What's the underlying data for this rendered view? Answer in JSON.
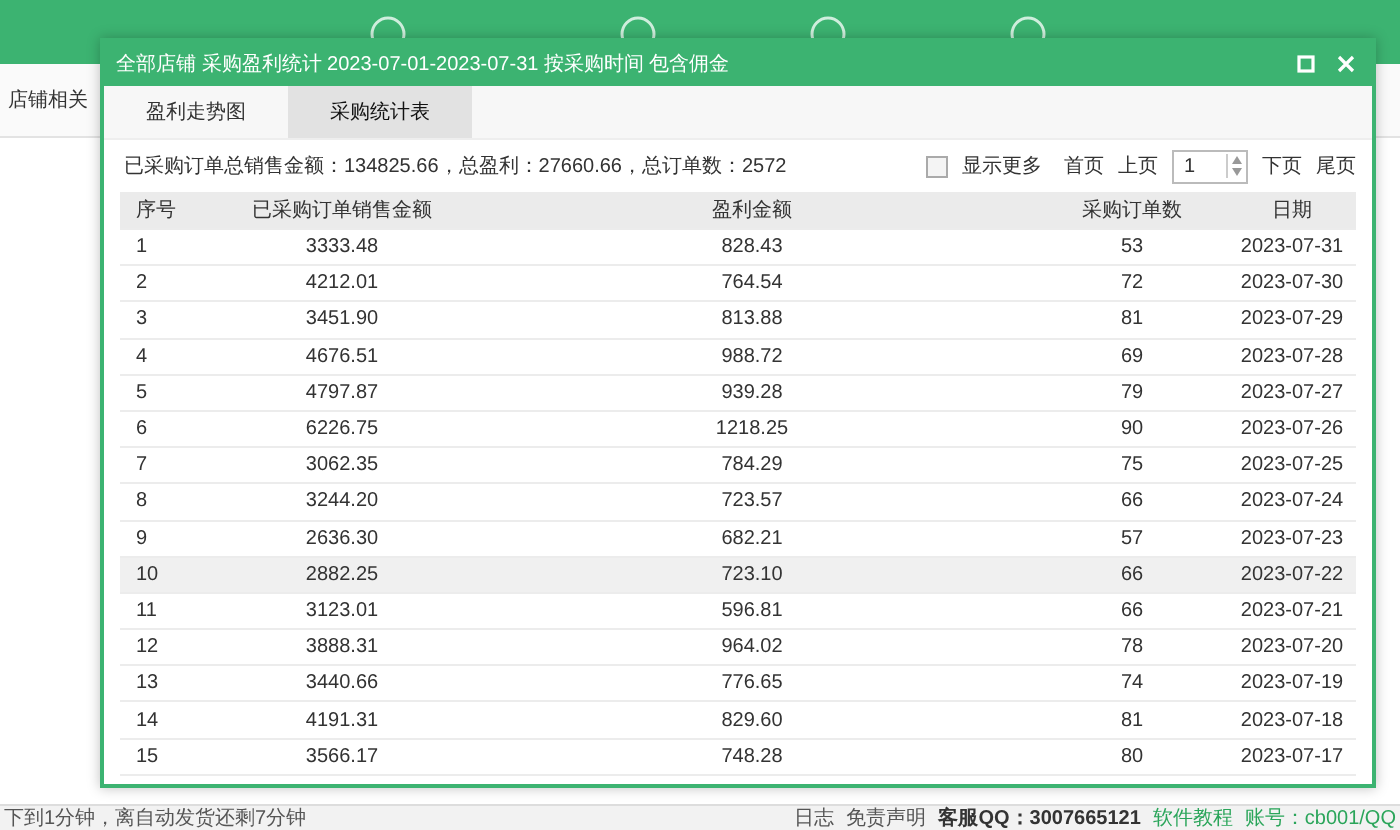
{
  "background": {
    "sidebar_item": "店铺相关",
    "status_left": "下到1分钟，离自动发货还剩7分钟",
    "status_links": [
      "日志",
      "免责声明"
    ],
    "contact": "客服QQ：3007665121",
    "tutorial": "软件教程",
    "account": "账号：cb001/QQ"
  },
  "dialog": {
    "title": "全部店铺 采购盈利统计 2023-07-01-2023-07-31 按采购时间 包含佣金",
    "tabs": [
      {
        "label": "盈利走势图",
        "selected": false
      },
      {
        "label": "采购统计表",
        "selected": true
      }
    ],
    "summary": "已采购订单总销售金额：134825.66，总盈利：27660.66，总订单数：2572",
    "show_more": {
      "label": "显示更多",
      "checked": false
    },
    "pager": {
      "first": "首页",
      "prev": "上页",
      "page": "1",
      "next": "下页",
      "last": "尾页"
    },
    "table": {
      "columns": [
        "序号",
        "已采购订单销售金额",
        "盈利金额",
        "采购订单数",
        "日期"
      ],
      "rows": [
        {
          "cells": [
            "1",
            "3333.48",
            "828.43",
            "53",
            "2023-07-31"
          ],
          "selected": false
        },
        {
          "cells": [
            "2",
            "4212.01",
            "764.54",
            "72",
            "2023-07-30"
          ],
          "selected": false
        },
        {
          "cells": [
            "3",
            "3451.90",
            "813.88",
            "81",
            "2023-07-29"
          ],
          "selected": false
        },
        {
          "cells": [
            "4",
            "4676.51",
            "988.72",
            "69",
            "2023-07-28"
          ],
          "selected": false
        },
        {
          "cells": [
            "5",
            "4797.87",
            "939.28",
            "79",
            "2023-07-27"
          ],
          "selected": false
        },
        {
          "cells": [
            "6",
            "6226.75",
            "1218.25",
            "90",
            "2023-07-26"
          ],
          "selected": false
        },
        {
          "cells": [
            "7",
            "3062.35",
            "784.29",
            "75",
            "2023-07-25"
          ],
          "selected": false
        },
        {
          "cells": [
            "8",
            "3244.20",
            "723.57",
            "66",
            "2023-07-24"
          ],
          "selected": false
        },
        {
          "cells": [
            "9",
            "2636.30",
            "682.21",
            "57",
            "2023-07-23"
          ],
          "selected": false
        },
        {
          "cells": [
            "10",
            "2882.25",
            "723.10",
            "66",
            "2023-07-22"
          ],
          "selected": true
        },
        {
          "cells": [
            "11",
            "3123.01",
            "596.81",
            "66",
            "2023-07-21"
          ],
          "selected": false
        },
        {
          "cells": [
            "12",
            "3888.31",
            "964.02",
            "78",
            "2023-07-20"
          ],
          "selected": false
        },
        {
          "cells": [
            "13",
            "3440.66",
            "776.65",
            "74",
            "2023-07-19"
          ],
          "selected": false
        },
        {
          "cells": [
            "14",
            "4191.31",
            "829.60",
            "81",
            "2023-07-18"
          ],
          "selected": false
        },
        {
          "cells": [
            "15",
            "3566.17",
            "748.28",
            "80",
            "2023-07-17"
          ],
          "selected": false
        }
      ]
    }
  }
}
